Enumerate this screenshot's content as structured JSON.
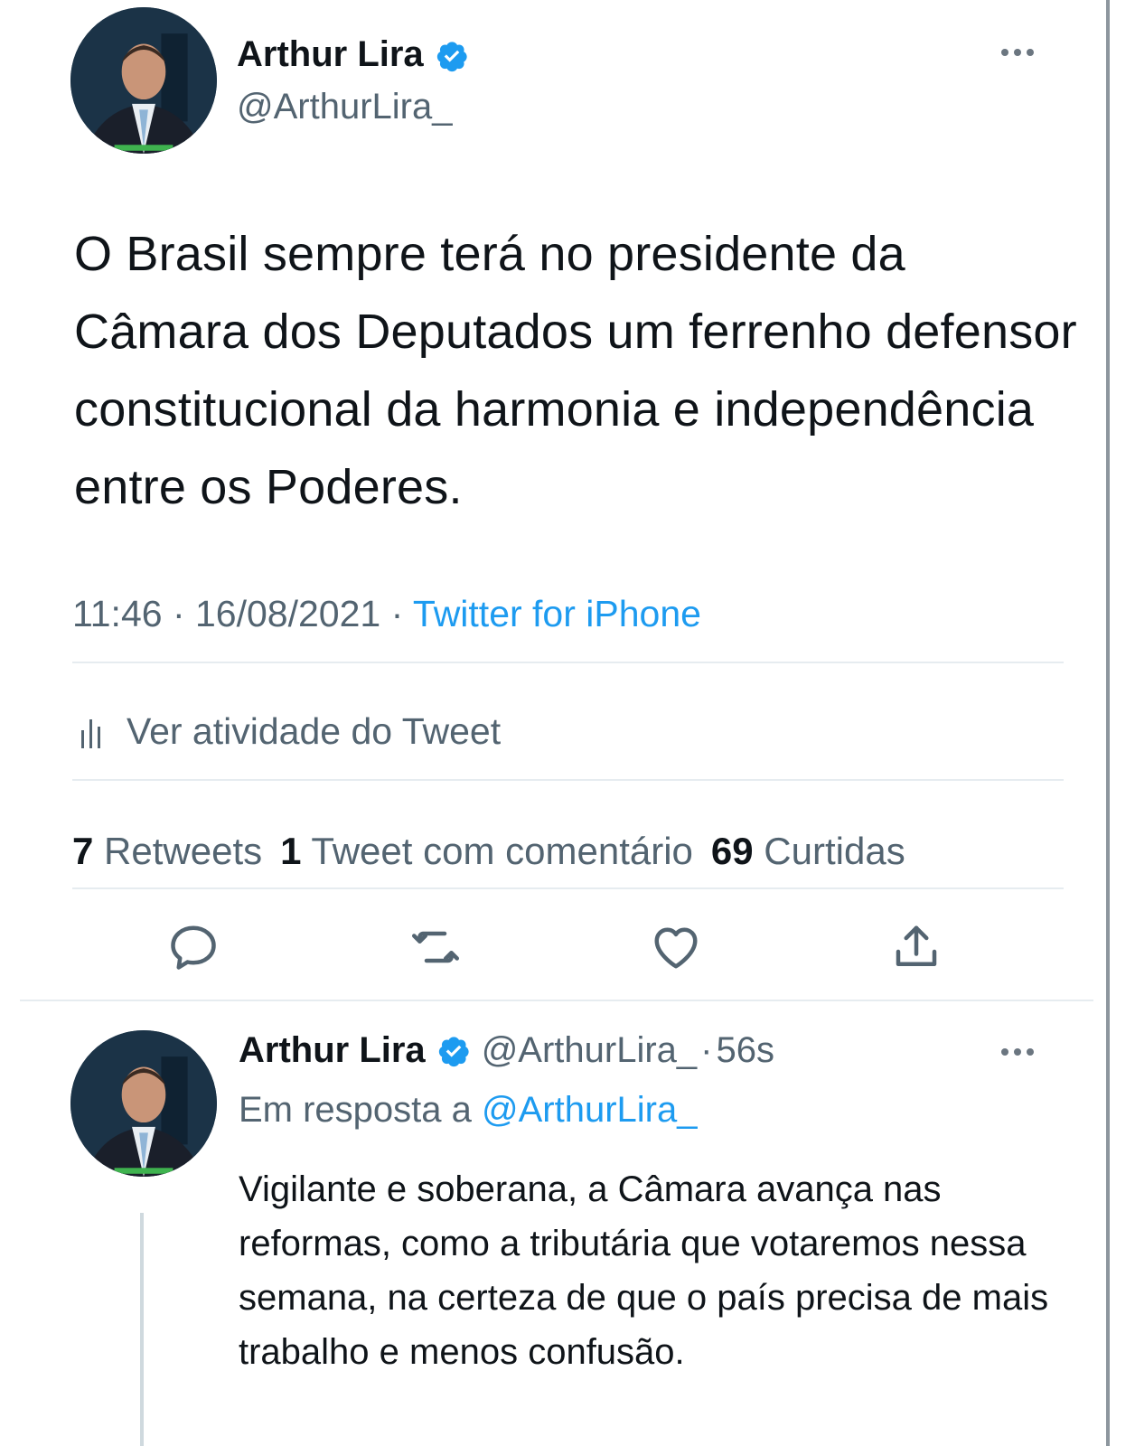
{
  "main_tweet": {
    "author_name": "Arthur Lira",
    "author_handle": "@ArthurLira_",
    "text": "O Brasil sempre terá no presidente da Câmara dos Deputados um ferrenho defensor constitucional da harmonia e independência entre os Poderes.",
    "time": "11:46",
    "date": "16/08/2021",
    "source": "Twitter for iPhone",
    "activity_label": "Ver atividade do Tweet",
    "stats": {
      "retweets_count": "7",
      "retweets_label": "Retweets",
      "quotes_count": "1",
      "quotes_label": "Tweet com comentário",
      "likes_count": "69",
      "likes_label": "Curtidas"
    },
    "actions": [
      "reply-icon",
      "retweet-icon",
      "like-icon",
      "share-icon"
    ]
  },
  "reply_tweet": {
    "author_name": "Arthur Lira",
    "author_handle": "@ArthurLira_",
    "age": "56s",
    "reply_to_prefix": "Em resposta a",
    "reply_to_handle": "@ArthurLira_",
    "text": "Vigilante e soberana, a Câmara avança nas reformas, como a tributária que votaremos nessa semana, na certeza de que o país precisa de mais trabalho e menos confusão."
  },
  "colors": {
    "accent": "#1d9bf0",
    "secondary_text": "#536471",
    "primary_text": "#0f1419",
    "divider": "#e6ecf0"
  },
  "icons": {
    "verified": "verified-badge-icon",
    "more": "more-options-icon",
    "activity": "analytics-bars-icon"
  }
}
